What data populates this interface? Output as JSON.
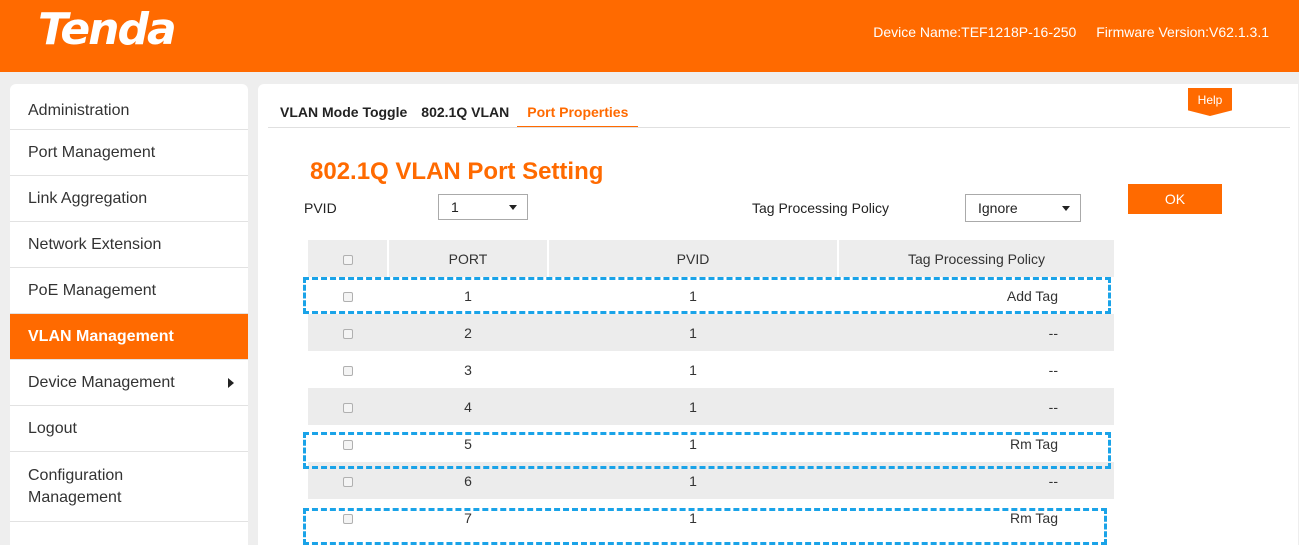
{
  "header": {
    "logo": "Tenda",
    "device_name": "Device Name:TEF1218P-16-250",
    "firmware_version": "Firmware Version:V62.1.3.1",
    "brand_color": "#ff6a00"
  },
  "sidebar": {
    "items": [
      {
        "label": "Administration",
        "active": false
      },
      {
        "label": "Port Management",
        "active": false
      },
      {
        "label": "Link Aggregation",
        "active": false
      },
      {
        "label": "Network Extension",
        "active": false
      },
      {
        "label": "PoE Management",
        "active": false
      },
      {
        "label": "VLAN Management",
        "active": true
      },
      {
        "label": "Device Management",
        "active": false,
        "icon": "triangle-right-icon"
      },
      {
        "label": "Logout",
        "active": false
      },
      {
        "label": "Configuration Management",
        "active": false
      }
    ]
  },
  "tabs": [
    {
      "label": "VLAN Mode Toggle",
      "active": false
    },
    {
      "label": "802.1Q VLAN",
      "active": false
    },
    {
      "label": "Port Properties",
      "active": true
    }
  ],
  "help_label": "Help",
  "page_title": "802.1Q VLAN Port Setting",
  "form": {
    "pvid_label": "PVID",
    "pvid_value": "1",
    "policy_label": "Tag Processing Policy",
    "policy_value": "Ignore",
    "ok_label": "OK"
  },
  "table": {
    "headers": {
      "port": "PORT",
      "pvid": "PVID",
      "policy": "Tag Processing Policy"
    },
    "rows": [
      {
        "port": "1",
        "pvid": "1",
        "policy": "Add Tag",
        "highlighted": true
      },
      {
        "port": "2",
        "pvid": "1",
        "policy": "--",
        "highlighted": false
      },
      {
        "port": "3",
        "pvid": "1",
        "policy": "--",
        "highlighted": false
      },
      {
        "port": "4",
        "pvid": "1",
        "policy": "--",
        "highlighted": false
      },
      {
        "port": "5",
        "pvid": "1",
        "policy": "Rm Tag",
        "highlighted": true
      },
      {
        "port": "6",
        "pvid": "1",
        "policy": "--",
        "highlighted": false
      },
      {
        "port": "7",
        "pvid": "1",
        "policy": "Rm Tag",
        "highlighted": true
      }
    ]
  },
  "highlight_color": "#1aa3e8"
}
